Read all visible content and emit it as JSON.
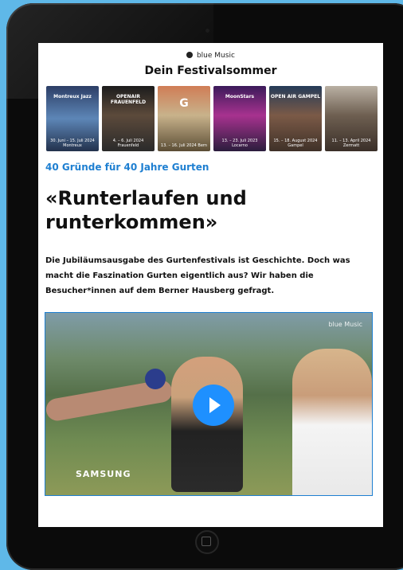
{
  "header": {
    "brand": "blue Music",
    "title": "Dein Festivalsommer"
  },
  "festival_tiles": [
    {
      "logo": "Montreux Jazz",
      "date": "30. Juni – 15. Juli 2024 Montreux",
      "color": "#3b5f8d"
    },
    {
      "logo": "OPENAIR FRAUENFELD",
      "date": "4. – 6. Juli 2024 Frauenfeld",
      "color": "#4b3a2d"
    },
    {
      "logo": "G",
      "date": "13. – 16. Juli 2024 Bern",
      "color": "#8b6a3f"
    },
    {
      "logo": "MoonStars",
      "date": "13. – 23. Juli 2023 Locarno",
      "color": "#5a2f7a"
    },
    {
      "logo": "OPEN AIR GAMPEL",
      "date": "15. – 18. August 2024 Gampel",
      "color": "#6a4e3b"
    },
    {
      "logo": "",
      "date": "11. – 13. April 2024 Zermatt",
      "color": "#7a6a5c"
    }
  ],
  "article": {
    "kicker": "40 Gründe für 40 Jahre Gurten",
    "headline": "«Runterlaufen und runterkommen»",
    "lead": "Die Jubiläumsausgabe des Gurtenfestivals ist Geschichte. Doch was macht die Faszination Gurten eigentlich aus? Wir haben die Besucher*innen auf dem Berner Hausberg gefragt."
  },
  "video": {
    "overlay_brand": "blue Music",
    "sponsor": "SAMSUNG"
  },
  "colors": {
    "accent": "#1e7fd1",
    "play": "#1e90ff"
  }
}
